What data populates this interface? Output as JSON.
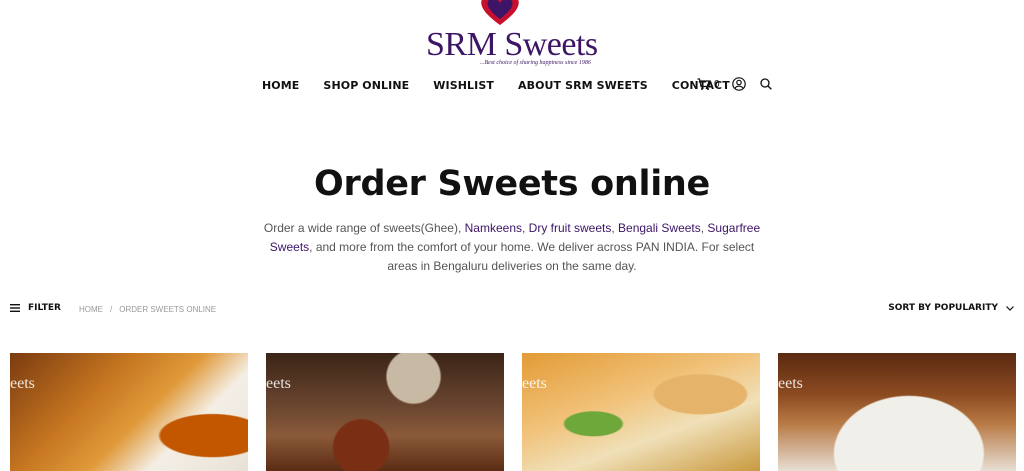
{
  "brand": {
    "name": "SRM Sweets",
    "tagline": "...Best choice of sharing happiness since 1986",
    "colors": {
      "primary": "#3d1566",
      "heart_red": "#c8102e"
    }
  },
  "nav": {
    "items": [
      {
        "label": "HOME"
      },
      {
        "label": "SHOP ONLINE"
      },
      {
        "label": "WISHLIST"
      },
      {
        "label": "ABOUT SRM SWEETS"
      },
      {
        "label": "CONTACT"
      }
    ]
  },
  "header_icons": {
    "cart_icon": "cart-icon",
    "cart_count": "0",
    "account_icon": "user-icon",
    "search_icon": "search-icon"
  },
  "hero": {
    "title": "Order Sweets online",
    "desc_1": "Order a wide range of sweets(Ghee), ",
    "link_1": "Namkeens",
    "sep_1": ", ",
    "link_2": "Dry fruit sweets",
    "sep_2": ", ",
    "link_3": "Bengali Sweets",
    "sep_3": ", ",
    "link_4": "Sugarfree Sweets",
    "desc_2": ", and more from the comfort of your home. We deliver across PAN INDIA. For select areas in Bengaluru deliveries on the same day."
  },
  "toolbar": {
    "filter_label": "FILTER",
    "breadcrumb_home": "HOME",
    "breadcrumb_sep": "/",
    "breadcrumb_current": "ORDER SWEETS ONLINE",
    "sort_label": "SORT BY POPULARITY"
  },
  "products": {
    "watermark": "eets"
  }
}
